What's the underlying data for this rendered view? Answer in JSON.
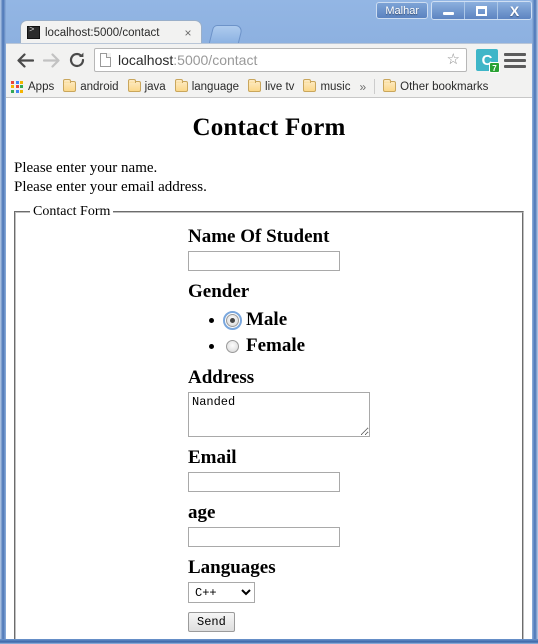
{
  "window": {
    "user_button": "Malhar",
    "minimize": "minimize-icon",
    "maximize": "maximize-icon",
    "close": "X"
  },
  "tab": {
    "title": "localhost:5000/contact",
    "close": "×",
    "favicon": "console-icon"
  },
  "toolbar": {
    "back": "back-icon",
    "forward": "forward-icon",
    "reload": "reload-icon",
    "url_host": "localhost",
    "url_rest": ":5000/contact",
    "star": "☆",
    "extension_letter": "C",
    "extension_badge": "7",
    "menu": "hamburger-icon"
  },
  "bookmarks": {
    "apps_label": "Apps",
    "items": [
      {
        "label": "android"
      },
      {
        "label": "java"
      },
      {
        "label": "language"
      },
      {
        "label": "live tv"
      },
      {
        "label": "music"
      }
    ],
    "overflow": "»",
    "other": "Other bookmarks"
  },
  "page": {
    "title": "Contact Form",
    "messages": [
      "Please enter your name.",
      "Please enter your email address."
    ],
    "fieldset_legend": "Contact Form",
    "fields": {
      "name_label": "Name Of Student",
      "name_value": "",
      "gender_label": "Gender",
      "gender_options": [
        {
          "label": "Male",
          "checked": true
        },
        {
          "label": "Female",
          "checked": false
        }
      ],
      "address_label": "Address",
      "address_value": "Nanded",
      "email_label": "Email",
      "email_value": "",
      "age_label": "age",
      "age_value": "",
      "languages_label": "Languages",
      "languages_selected": "C++",
      "languages_options": [
        "C++"
      ],
      "submit_label": "Send"
    }
  },
  "colors": {
    "title_bar": "#6e96cd",
    "chrome_bg": "#f2f2f1",
    "extension_teal": "#3fb6c8",
    "badge_green": "#2aa233",
    "focus_blue": "#7aa7dd"
  }
}
